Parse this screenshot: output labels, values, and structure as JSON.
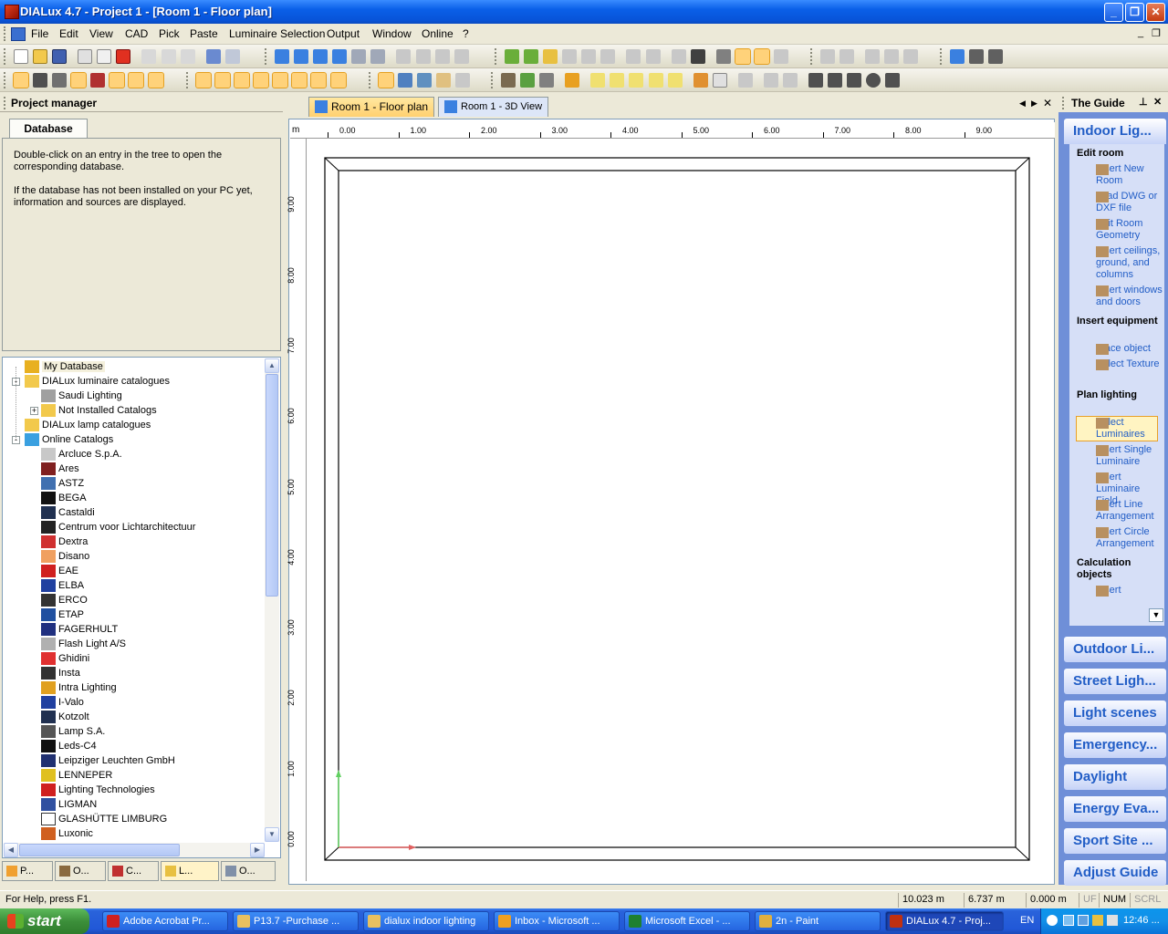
{
  "window": {
    "title": "DIALux 4.7 - Project 1 - [Room 1 - Floor plan]"
  },
  "menubar": {
    "items": [
      "File",
      "Edit",
      "View",
      "CAD",
      "Pick",
      "Paste",
      "Luminaire Selection",
      "Output",
      "Window",
      "Online",
      "?"
    ]
  },
  "project_manager": {
    "title": "Project manager",
    "tab": "Database",
    "info_lines": [
      "Double-click on an entry in the tree to open the corresponding database.",
      "If the database has not been installed on your PC yet, information and sources are displayed."
    ],
    "tree": [
      {
        "label": "My Database",
        "level": 0,
        "icon": "user-db-icon",
        "color": "#E8B020",
        "highlight": true
      },
      {
        "label": "DIALux luminaire catalogues",
        "level": 0,
        "icon": "folder-icon",
        "color": "#F2C94C",
        "expand": "-"
      },
      {
        "label": "Saudi Lighting",
        "level": 1,
        "icon": "catalog-icon",
        "color": "#A0A0A0"
      },
      {
        "label": "Not Installed Catalogs",
        "level": 1,
        "icon": "folder-icon",
        "color": "#F2C94C",
        "expand": "+"
      },
      {
        "label": "DIALux lamp catalogues",
        "level": 0,
        "icon": "folder-icon",
        "color": "#F2C94C"
      },
      {
        "label": "Online Catalogs",
        "level": 0,
        "icon": "globe-folder-icon",
        "color": "#3AA0E0",
        "expand": "-"
      },
      {
        "label": "Arcluce S.p.A.",
        "level": 1,
        "icon": "logo-icon",
        "color": "#C8C8C8"
      },
      {
        "label": "Ares",
        "level": 1,
        "icon": "logo-icon",
        "color": "#802020"
      },
      {
        "label": "ASTZ",
        "level": 1,
        "icon": "logo-icon",
        "color": "#4070B0"
      },
      {
        "label": "BEGA",
        "level": 1,
        "icon": "logo-icon",
        "color": "#111111"
      },
      {
        "label": "Castaldi",
        "level": 1,
        "icon": "logo-icon",
        "color": "#203050"
      },
      {
        "label": "Centrum voor Lichtarchitectuur",
        "level": 1,
        "icon": "logo-icon",
        "color": "#222222"
      },
      {
        "label": "Dextra",
        "level": 1,
        "icon": "logo-icon",
        "color": "#D03030"
      },
      {
        "label": "Disano",
        "level": 1,
        "icon": "logo-icon",
        "color": "#F0A060"
      },
      {
        "label": "EAE",
        "level": 1,
        "icon": "logo-icon",
        "color": "#D02020"
      },
      {
        "label": "ELBA",
        "level": 1,
        "icon": "logo-icon",
        "color": "#2040A0"
      },
      {
        "label": "ERCO",
        "level": 1,
        "icon": "logo-icon",
        "color": "#333333"
      },
      {
        "label": "ETAP",
        "level": 1,
        "icon": "logo-icon",
        "color": "#2050A0"
      },
      {
        "label": "FAGERHULT",
        "level": 1,
        "icon": "logo-icon",
        "color": "#203080"
      },
      {
        "label": "Flash Light A/S",
        "level": 1,
        "icon": "logo-icon",
        "color": "#B0B0B0"
      },
      {
        "label": "Ghidini",
        "level": 1,
        "icon": "logo-icon",
        "color": "#E03030"
      },
      {
        "label": "Insta",
        "level": 1,
        "icon": "logo-icon",
        "color": "#333333"
      },
      {
        "label": "Intra Lighting",
        "level": 1,
        "icon": "logo-icon",
        "color": "#E0A020"
      },
      {
        "label": "I-Valo",
        "level": 1,
        "icon": "logo-icon",
        "color": "#2040A0"
      },
      {
        "label": "Kotzolt",
        "level": 1,
        "icon": "logo-icon",
        "color": "#203050"
      },
      {
        "label": "Lamp S.A.",
        "level": 1,
        "icon": "logo-icon",
        "color": "#555555"
      },
      {
        "label": "Leds-C4",
        "level": 1,
        "icon": "logo-icon",
        "color": "#111111"
      },
      {
        "label": "Leipziger Leuchten GmbH",
        "level": 1,
        "icon": "logo-icon",
        "color": "#203070"
      },
      {
        "label": "LENNEPER",
        "level": 1,
        "icon": "logo-icon",
        "color": "#E0C020"
      },
      {
        "label": "Lighting Technologies",
        "level": 1,
        "icon": "logo-icon",
        "color": "#D02020"
      },
      {
        "label": "LIGMAN",
        "level": 1,
        "icon": "logo-icon",
        "color": "#3050A0"
      },
      {
        "label": "GLASHÜTTE LIMBURG",
        "level": 1,
        "icon": "logo-icon",
        "color": "#FFFFFF"
      },
      {
        "label": "Luxonic",
        "level": 1,
        "icon": "logo-icon",
        "color": "#D06020"
      }
    ],
    "bottom_tabs": [
      "P...",
      "O...",
      "C...",
      "L...",
      "O..."
    ]
  },
  "view_tabs": [
    {
      "label": "Room 1 - Floor plan",
      "active": true
    },
    {
      "label": "Room 1 - 3D View",
      "active": false
    }
  ],
  "ruler": {
    "unit": "m",
    "x_ticks": [
      "0.00",
      "1.00",
      "2.00",
      "3.00",
      "4.00",
      "5.00",
      "6.00",
      "7.00",
      "8.00",
      "9.00"
    ],
    "y_ticks": [
      "9.00",
      "8.00",
      "7.00",
      "6.00",
      "5.00",
      "4.00",
      "3.00",
      "2.00",
      "1.00",
      "0.00"
    ]
  },
  "guide": {
    "title": "The Guide",
    "active_section": "Indoor Lig...",
    "categories": [
      {
        "title": "Edit room",
        "items": [
          {
            "label": "Insert New Room",
            "icon": "room-icon"
          },
          {
            "label": "Load DWG or DXF file",
            "icon": "dxf-icon"
          },
          {
            "label": "Edit Room Geometry",
            "icon": "geometry-icon"
          },
          {
            "label": "Insert ceilings, ground, and columns",
            "icon": "column-icon"
          },
          {
            "label": "Insert windows and doors",
            "icon": "door-icon"
          }
        ]
      },
      {
        "title": "Insert equipment",
        "items": [
          {
            "label": "Place object",
            "icon": "table-icon"
          },
          {
            "label": "Select Texture",
            "icon": "texture-icon"
          }
        ]
      },
      {
        "title": "Plan lighting",
        "items": [
          {
            "label": "Select Luminaires",
            "icon": "luminaire-icon",
            "selected": true
          },
          {
            "label": "Insert Single Luminaire",
            "icon": "single-luminaire-icon"
          },
          {
            "label": "Insert Luminaire Field",
            "icon": "field-icon"
          },
          {
            "label": "Insert Line Arrangement",
            "icon": "line-arrangement-icon"
          },
          {
            "label": "Insert Circle Arrangement",
            "icon": "circle-arrangement-icon"
          }
        ]
      },
      {
        "title": "Calculation objects",
        "items": [
          {
            "label": "Insert",
            "icon": "calc-icon"
          }
        ]
      }
    ],
    "sections": [
      "Outdoor Li...",
      "Street Ligh...",
      "Light scenes",
      "Emergency...",
      "Daylight",
      "Energy Eva...",
      "Sport Site ...",
      "Adjust Guide"
    ]
  },
  "statusbar": {
    "help": "For Help, press F1.",
    "x": "10.023 m",
    "y": "6.737 m",
    "z": "0.000 m",
    "ind1": "UF",
    "ind2": "NUM",
    "ind3": "SCRL"
  },
  "taskbar": {
    "start": "start",
    "tasks": [
      {
        "label": "Adobe Acrobat Pr...",
        "color": "#D02020"
      },
      {
        "label": "P13.7 -Purchase ...",
        "color": "#E8C060"
      },
      {
        "label": "dialux indoor lighting",
        "color": "#E8C060"
      },
      {
        "label": "Inbox - Microsoft ...",
        "color": "#F0A020"
      },
      {
        "label": "Microsoft Excel - ...",
        "color": "#1E8030"
      },
      {
        "label": "2n - Paint",
        "color": "#E0B040"
      },
      {
        "label": "DIALux 4.7 - Proj...",
        "color": "#C03010",
        "active": true
      }
    ],
    "lang": "EN",
    "clock": "12:46 ..."
  }
}
